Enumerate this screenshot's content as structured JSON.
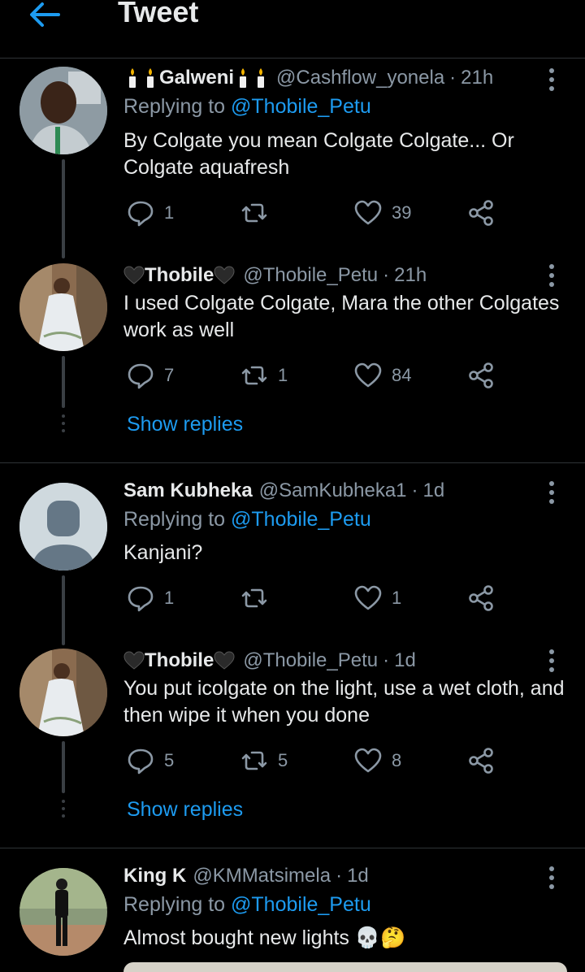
{
  "header": {
    "title": "Tweet",
    "back_icon": "arrow-left-icon",
    "accent": "#1d9bf0"
  },
  "tweets": [
    {
      "name": "Galweni",
      "handle": "@Cashflow_yonela",
      "time": "21h",
      "replying_prefix": "Replying to",
      "replying_to": "@Thobile_Petu",
      "text": "By Colgate you mean Colgate Colgate... Or Colgate aquafresh",
      "replies": "1",
      "retweets": "",
      "likes": "39"
    },
    {
      "name": "Thobile",
      "handle": "@Thobile_Petu",
      "time": "21h",
      "text": "I used Colgate Colgate, Mara the other Colgates work as well",
      "replies": "7",
      "retweets": "1",
      "likes": "84",
      "show_replies": "Show replies"
    },
    {
      "name": "Sam Kubheka",
      "handle": "@SamKubheka1",
      "time": "1d",
      "replying_prefix": "Replying to",
      "replying_to": "@Thobile_Petu",
      "text": "Kanjani?",
      "replies": "1",
      "retweets": "",
      "likes": "1"
    },
    {
      "name": "Thobile",
      "handle": "@Thobile_Petu",
      "time": "1d",
      "text": "You put icolgate on the light, use a wet cloth, and then wipe it when you done",
      "replies": "5",
      "retweets": "5",
      "likes": "8",
      "show_replies": "Show replies"
    },
    {
      "name": "King K",
      "handle": "@KMMatsimela",
      "time": "1d",
      "replying_prefix": "Replying to",
      "replying_to": "@Thobile_Petu",
      "text": "Almost bought new lights 💀🤔"
    }
  ],
  "separator": "·"
}
